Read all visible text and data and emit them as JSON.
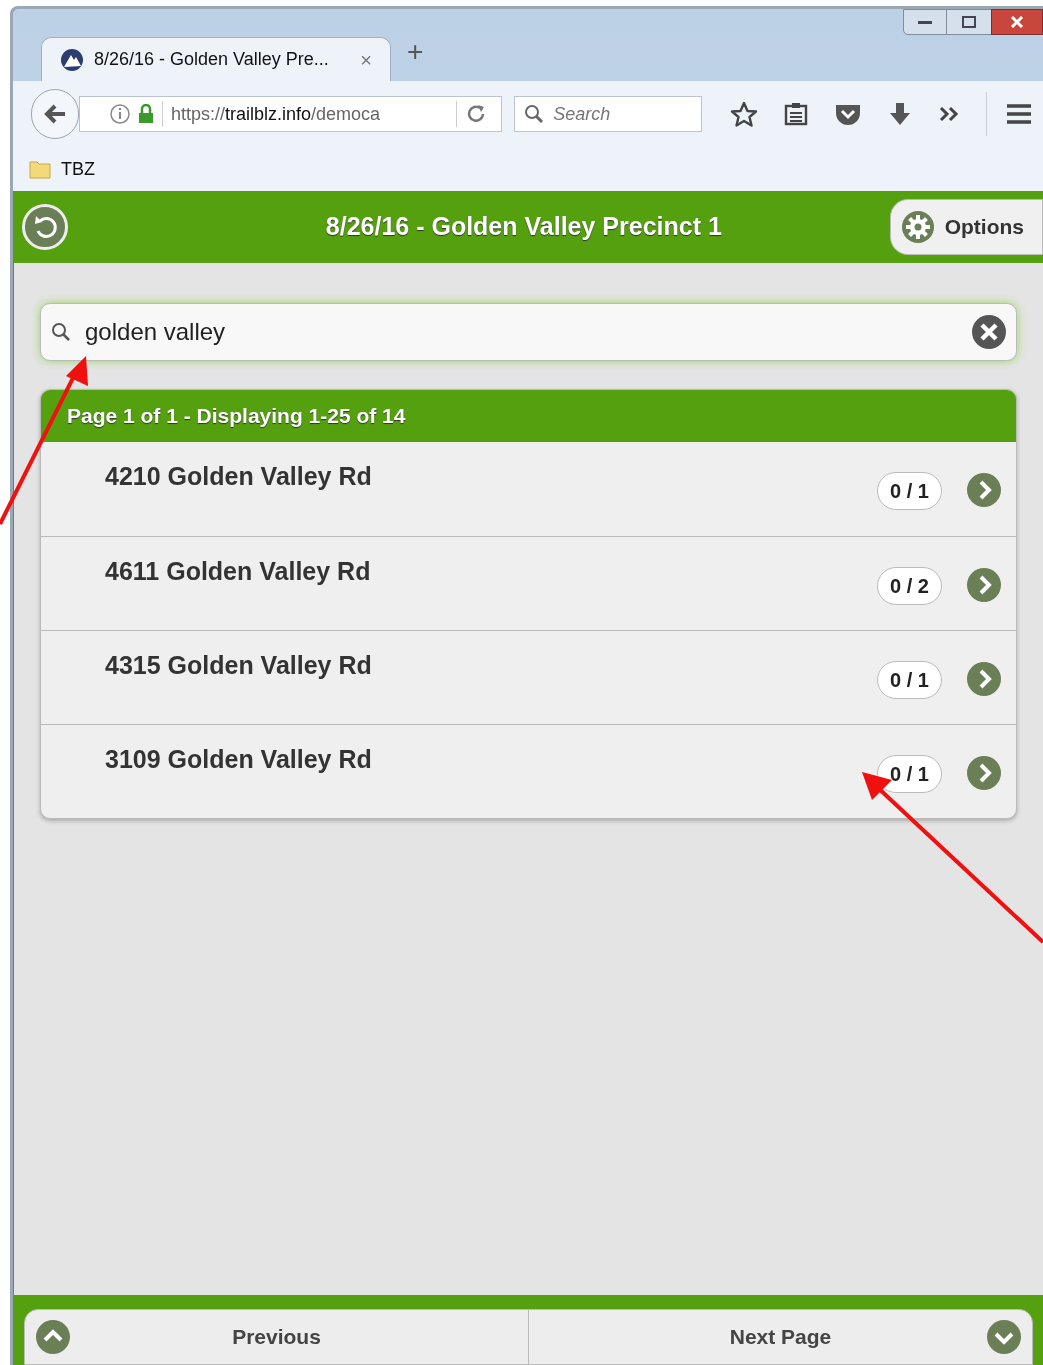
{
  "browser": {
    "tab_title": "8/26/16 - Golden Valley Pre...",
    "tab_close": "×",
    "new_tab": "+",
    "url_prefix": "https://",
    "url_domain": "trailblz.info",
    "url_path": "/democa",
    "search_placeholder": "Search",
    "bookmarks": [
      "TBZ"
    ]
  },
  "header": {
    "title": "8/26/16 - Golden Valley Precinct 1",
    "options_label": "Options"
  },
  "search": {
    "value": "golden valley"
  },
  "list": {
    "header": "Page 1 of 1 - Displaying 1-25 of 14",
    "items": [
      {
        "address": "4210 Golden Valley Rd",
        "count": "0 / 1"
      },
      {
        "address": "4611 Golden Valley Rd",
        "count": "0 / 2"
      },
      {
        "address": "4315 Golden Valley Rd",
        "count": "0 / 1"
      },
      {
        "address": "3109 Golden Valley Rd",
        "count": "0 / 1"
      }
    ]
  },
  "footer": {
    "previous": "Previous",
    "next": "Next Page"
  }
}
